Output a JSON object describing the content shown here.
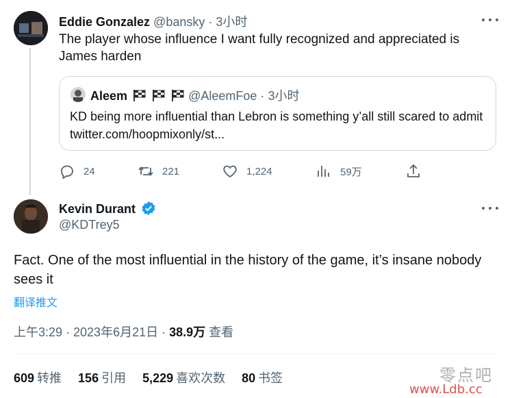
{
  "original_tweet": {
    "author_name": "Eddie Gonzalez",
    "handle": "@bansky",
    "separator": "·",
    "time": "3小时",
    "text": "The player whose influence I want fully recognized and appreciated is James harden",
    "quoted": {
      "author_name": "Aleem",
      "handle": "@AleemFoe",
      "time": "3小时",
      "text": "KD being more influential than Lebron is something y’all still scared to admit twitter.com/hoopmixonly/st..."
    },
    "actions": {
      "replies": "24",
      "retweets": "221",
      "likes": "1,224",
      "views": "59万"
    }
  },
  "reply_tweet": {
    "author_name": "Kevin Durant",
    "handle": "@KDTrey5",
    "text": "Fact. One of the most influential in the history of the game, it’s insane nobody sees it",
    "translate_label": "翻译推文",
    "timestamp": "上午3:29 · 2023年6月21日 · ",
    "views_count": "38.9万",
    "views_label": " 查看",
    "stats": {
      "retweets_count": "609",
      "retweets_label": "转推",
      "quotes_count": "156",
      "quotes_label": "引用",
      "likes_count": "5,229",
      "likes_label": "喜欢次数",
      "bookmarks_count": "80",
      "bookmarks_label": "书签"
    }
  },
  "watermark": {
    "text_cn": "零点吧",
    "url": "www.Ldb.cc"
  },
  "colors": {
    "accent": "#1d9bf0",
    "muted": "#536471",
    "border": "#cfd9de"
  }
}
